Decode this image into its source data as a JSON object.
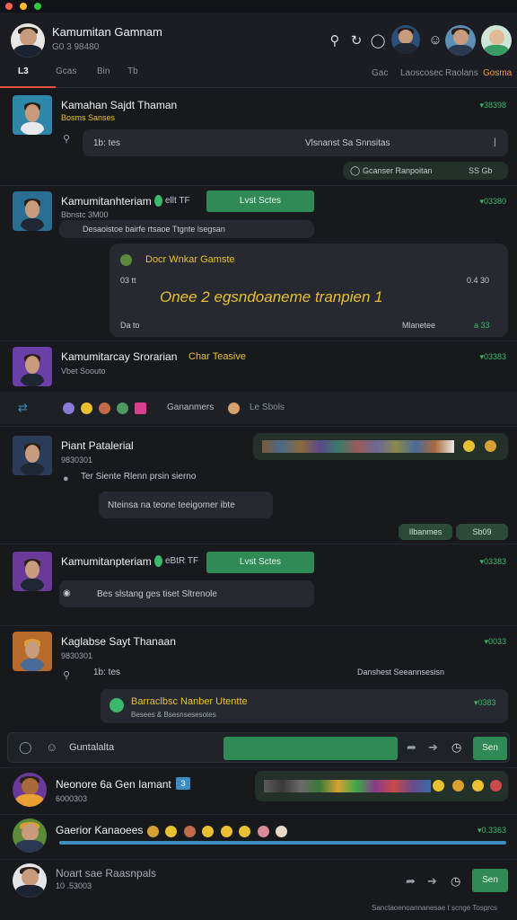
{
  "window_title": "",
  "header": {
    "name": "Kamumitan Gamnam",
    "subtitle": "G0 3 98480",
    "tabs": [
      "L3",
      "Gcas",
      "Bin",
      "Tb"
    ],
    "right_tabs": [
      "Gac",
      "Laoscosec",
      "Raolans",
      "Gosma"
    ],
    "active_right_tab": "Gosma"
  },
  "chats": [
    {
      "name": "Kamahan Sajdt Thaman",
      "meta": "Bosms Sanses",
      "time": "▾38398",
      "msg_left": "1b: tes",
      "msg_right": "Vlsnanst Sa Snnsitas",
      "reply": "Gcanser Ranpoitan",
      "reply_count": "SS Gb"
    },
    {
      "name": "Kamumitanhteriam",
      "extra": "ellt TF",
      "button": "Lvst Sctes",
      "meta": "Bbnstc 3M00",
      "time": "▾03380",
      "line": "Desaoistoe bairfe rtsaoe Ttgnte lsegsan",
      "card_title": "Docr Wnkar Gamste",
      "card_count": "03 tt",
      "card_count_right": "0.4 30",
      "card_body": "Onee 2 egsndoaneme tranpien 1",
      "card_time": "Da to",
      "card_foot": "Mlanetee",
      "card_foot_count": "a 33"
    },
    {
      "name": "Kamumitarcay Srorarian",
      "accent": "Char Teasive",
      "meta": "Vbet Soouto",
      "time": "▾03383",
      "reactions_label": "Gananmers",
      "reactions_extra": "Le Sbols"
    },
    {
      "name": "Piant Patalerial",
      "meta": "9830301",
      "time": "",
      "line1": "Ter Siente Rlenn prsin sierno",
      "line2": "Nteinsa na teone teeigomer ibte",
      "chip1": "Ilbanmes",
      "chip2": "Sb09"
    },
    {
      "name": "Kamumitanpteriam",
      "extra": "eBtR TF",
      "button": "Lvst Sctes",
      "meta": "",
      "time": "▾03383",
      "line": "Bes slstang ges tiset Sltrenole"
    },
    {
      "name": "Kaglabse Sayt Thanaan",
      "meta": "9830301",
      "time": "▾0033",
      "msg_left": "1b: tes",
      "msg_right": "Danshest Seeannsesisn",
      "card_title": "Barraclbsc Nanber Utentte",
      "card_sub": "Besees & Bsesnsesesotes",
      "card_time": "▾0383"
    }
  ],
  "composer": {
    "placeholder": "Guntalalta",
    "send_label": "Sen"
  },
  "bottom_chats": [
    {
      "name": "Neonore 6a Gen Iamant",
      "meta": "6000303",
      "badge": "3"
    },
    {
      "name": "Gaerior Kanaoees",
      "meta": "",
      "time": "▾0.3363",
      "progress": 1.0
    },
    {
      "name": "Noart sae Raasnpals",
      "meta": "10 .53003",
      "send_label": "Sen"
    }
  ],
  "footer_text": "Sanctaoenoannanesae t scnge Tosprcs",
  "colors": {
    "accent_green": "#2f8a55",
    "time_green": "#3fb86b",
    "gold": "#e8c032",
    "tab_underline": "#e5533c"
  },
  "icons": [
    "search-icon",
    "refresh-icon",
    "circle-icon",
    "bot-icon",
    "settings-icon",
    "send-icon",
    "forward-icon",
    "attach-icon",
    "emoji-icon"
  ]
}
